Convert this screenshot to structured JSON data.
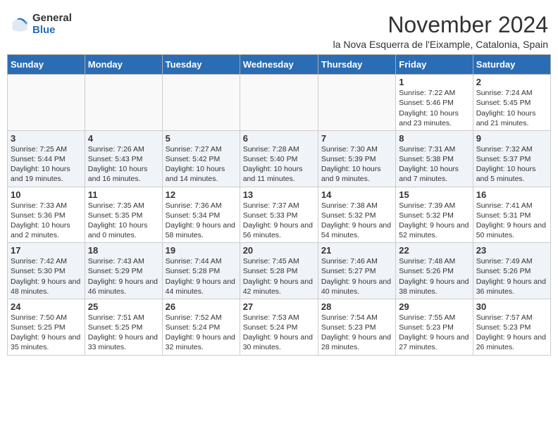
{
  "logo": {
    "general": "General",
    "blue": "Blue"
  },
  "title": "November 2024",
  "location": "la Nova Esquerra de l'Eixample, Catalonia, Spain",
  "days_header": [
    "Sunday",
    "Monday",
    "Tuesday",
    "Wednesday",
    "Thursday",
    "Friday",
    "Saturday"
  ],
  "weeks": [
    [
      {
        "day": "",
        "info": ""
      },
      {
        "day": "",
        "info": ""
      },
      {
        "day": "",
        "info": ""
      },
      {
        "day": "",
        "info": ""
      },
      {
        "day": "",
        "info": ""
      },
      {
        "day": "1",
        "info": "Sunrise: 7:22 AM\nSunset: 5:46 PM\nDaylight: 10 hours and 23 minutes."
      },
      {
        "day": "2",
        "info": "Sunrise: 7:24 AM\nSunset: 5:45 PM\nDaylight: 10 hours and 21 minutes."
      }
    ],
    [
      {
        "day": "3",
        "info": "Sunrise: 7:25 AM\nSunset: 5:44 PM\nDaylight: 10 hours and 19 minutes."
      },
      {
        "day": "4",
        "info": "Sunrise: 7:26 AM\nSunset: 5:43 PM\nDaylight: 10 hours and 16 minutes."
      },
      {
        "day": "5",
        "info": "Sunrise: 7:27 AM\nSunset: 5:42 PM\nDaylight: 10 hours and 14 minutes."
      },
      {
        "day": "6",
        "info": "Sunrise: 7:28 AM\nSunset: 5:40 PM\nDaylight: 10 hours and 11 minutes."
      },
      {
        "day": "7",
        "info": "Sunrise: 7:30 AM\nSunset: 5:39 PM\nDaylight: 10 hours and 9 minutes."
      },
      {
        "day": "8",
        "info": "Sunrise: 7:31 AM\nSunset: 5:38 PM\nDaylight: 10 hours and 7 minutes."
      },
      {
        "day": "9",
        "info": "Sunrise: 7:32 AM\nSunset: 5:37 PM\nDaylight: 10 hours and 5 minutes."
      }
    ],
    [
      {
        "day": "10",
        "info": "Sunrise: 7:33 AM\nSunset: 5:36 PM\nDaylight: 10 hours and 2 minutes."
      },
      {
        "day": "11",
        "info": "Sunrise: 7:35 AM\nSunset: 5:35 PM\nDaylight: 10 hours and 0 minutes."
      },
      {
        "day": "12",
        "info": "Sunrise: 7:36 AM\nSunset: 5:34 PM\nDaylight: 9 hours and 58 minutes."
      },
      {
        "day": "13",
        "info": "Sunrise: 7:37 AM\nSunset: 5:33 PM\nDaylight: 9 hours and 56 minutes."
      },
      {
        "day": "14",
        "info": "Sunrise: 7:38 AM\nSunset: 5:32 PM\nDaylight: 9 hours and 54 minutes."
      },
      {
        "day": "15",
        "info": "Sunrise: 7:39 AM\nSunset: 5:32 PM\nDaylight: 9 hours and 52 minutes."
      },
      {
        "day": "16",
        "info": "Sunrise: 7:41 AM\nSunset: 5:31 PM\nDaylight: 9 hours and 50 minutes."
      }
    ],
    [
      {
        "day": "17",
        "info": "Sunrise: 7:42 AM\nSunset: 5:30 PM\nDaylight: 9 hours and 48 minutes."
      },
      {
        "day": "18",
        "info": "Sunrise: 7:43 AM\nSunset: 5:29 PM\nDaylight: 9 hours and 46 minutes."
      },
      {
        "day": "19",
        "info": "Sunrise: 7:44 AM\nSunset: 5:28 PM\nDaylight: 9 hours and 44 minutes."
      },
      {
        "day": "20",
        "info": "Sunrise: 7:45 AM\nSunset: 5:28 PM\nDaylight: 9 hours and 42 minutes."
      },
      {
        "day": "21",
        "info": "Sunrise: 7:46 AM\nSunset: 5:27 PM\nDaylight: 9 hours and 40 minutes."
      },
      {
        "day": "22",
        "info": "Sunrise: 7:48 AM\nSunset: 5:26 PM\nDaylight: 9 hours and 38 minutes."
      },
      {
        "day": "23",
        "info": "Sunrise: 7:49 AM\nSunset: 5:26 PM\nDaylight: 9 hours and 36 minutes."
      }
    ],
    [
      {
        "day": "24",
        "info": "Sunrise: 7:50 AM\nSunset: 5:25 PM\nDaylight: 9 hours and 35 minutes."
      },
      {
        "day": "25",
        "info": "Sunrise: 7:51 AM\nSunset: 5:25 PM\nDaylight: 9 hours and 33 minutes."
      },
      {
        "day": "26",
        "info": "Sunrise: 7:52 AM\nSunset: 5:24 PM\nDaylight: 9 hours and 32 minutes."
      },
      {
        "day": "27",
        "info": "Sunrise: 7:53 AM\nSunset: 5:24 PM\nDaylight: 9 hours and 30 minutes."
      },
      {
        "day": "28",
        "info": "Sunrise: 7:54 AM\nSunset: 5:23 PM\nDaylight: 9 hours and 28 minutes."
      },
      {
        "day": "29",
        "info": "Sunrise: 7:55 AM\nSunset: 5:23 PM\nDaylight: 9 hours and 27 minutes."
      },
      {
        "day": "30",
        "info": "Sunrise: 7:57 AM\nSunset: 5:23 PM\nDaylight: 9 hours and 26 minutes."
      }
    ]
  ]
}
